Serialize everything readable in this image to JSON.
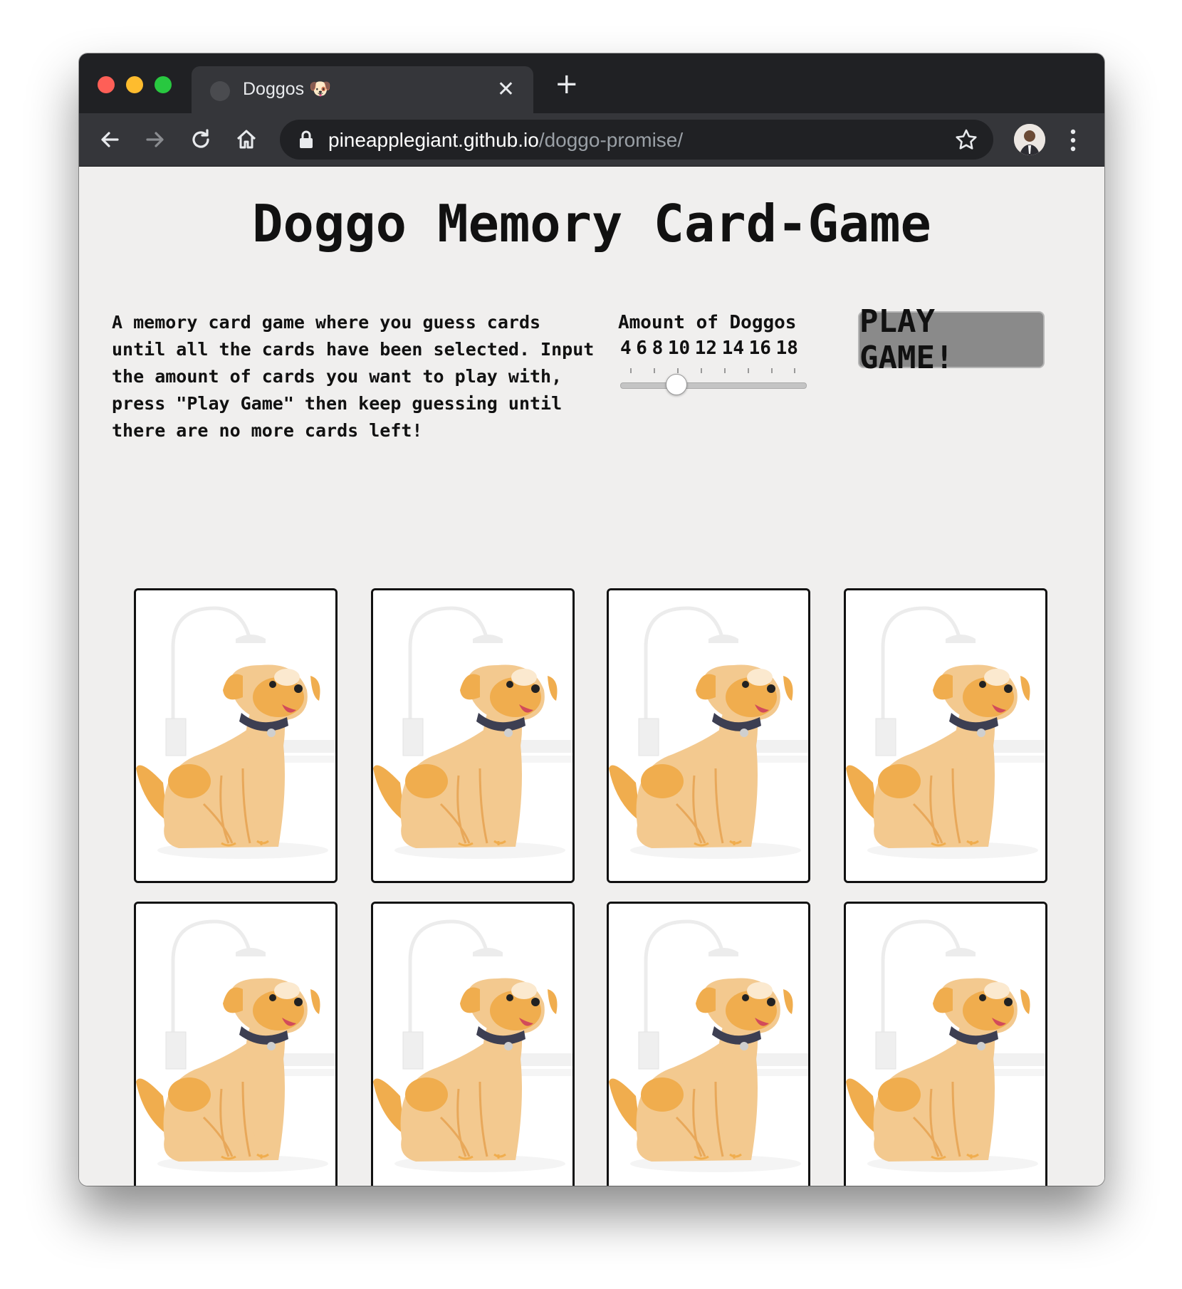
{
  "browser": {
    "tab_title": "Doggos 🐶",
    "tab_close": "✕",
    "new_tab": "+",
    "url_host": "pineapplegiant.github.io",
    "url_path": "/doggo-promise/"
  },
  "game": {
    "title": "Doggo Memory Card-Game",
    "description": "A memory card game where you guess cards until all the cards have been selected. Input the amount of cards you want to play with, press \"Play Game\" then keep guessing until there are no more cards left!",
    "amount_label": "Amount of Doggos",
    "amount_options": [
      "4",
      "6",
      "8",
      "10",
      "12",
      "14",
      "16",
      "18"
    ],
    "amount_selected": "8",
    "play_button": "PLAY GAME!"
  },
  "cards": [
    {
      "id": 1
    },
    {
      "id": 2
    },
    {
      "id": 3
    },
    {
      "id": 4
    },
    {
      "id": 5
    },
    {
      "id": 6
    },
    {
      "id": 7
    },
    {
      "id": 8
    }
  ],
  "icons": {
    "back": "arrow-left-icon",
    "forward": "arrow-right-icon",
    "reload": "reload-icon",
    "home": "home-icon",
    "lock": "lock-icon",
    "star": "star-icon",
    "menu": "kebab-menu-icon"
  },
  "colors": {
    "page_bg": "#f0efee",
    "chrome_dark": "#202124",
    "chrome_toolbar": "#35363a",
    "button_bg": "#8a8a8a",
    "dog_body": "#f3c98f",
    "dog_dark": "#f0ad4e",
    "collar": "#3d3f52"
  }
}
